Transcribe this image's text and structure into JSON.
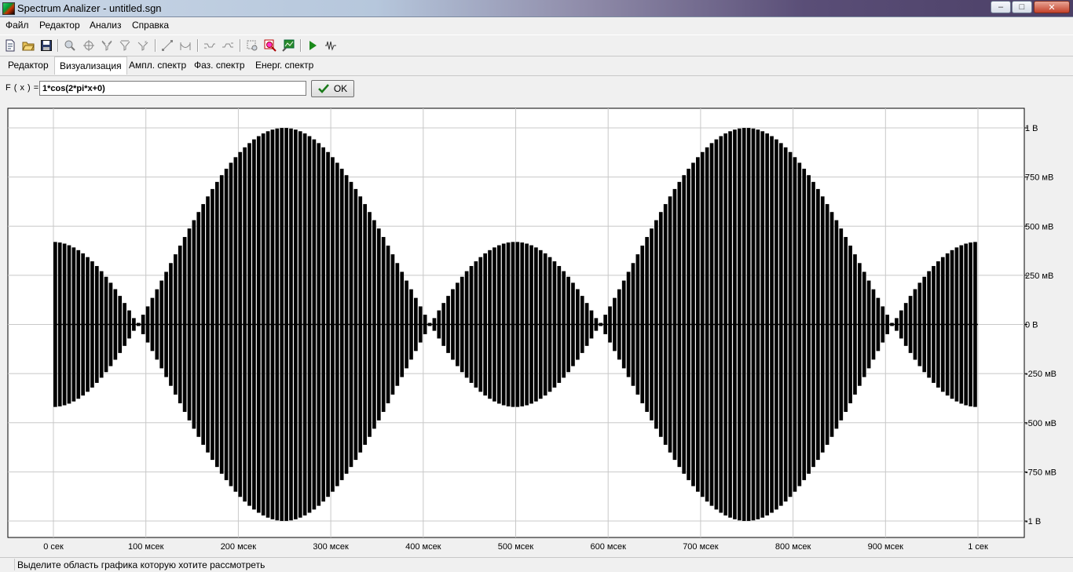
{
  "window": {
    "title": "Spectrum Analizer - untitled.sgn",
    "controls": {
      "minimize": "–",
      "maximize": "□",
      "close": "✕"
    }
  },
  "menu": [
    "Файл",
    "Редактор",
    "Анализ",
    "Справка"
  ],
  "toolbar": {
    "icons": [
      "new-file-icon",
      "open-folder-icon",
      "save-icon",
      "zoom-icon",
      "target-icon",
      "filter-icon",
      "filter2-icon",
      "filter3-icon",
      "line-icon",
      "bridge-icon",
      "wave-left-icon",
      "wave-right-icon",
      "select-rect-icon",
      "zoom-rect-icon",
      "chart-icon",
      "play-icon",
      "signal-icon"
    ]
  },
  "tabs": [
    {
      "label": "Редактор",
      "active": false
    },
    {
      "label": "Визуализация",
      "active": true
    },
    {
      "label": "Ампл. спектр",
      "active": false
    },
    {
      "label": "Фаз. спектр",
      "active": false
    },
    {
      "label": "Енерг. спектр",
      "active": false
    }
  ],
  "formula": {
    "label": "F ( x ) =",
    "value": "1*cos(2*pi*x+0)",
    "ok_label": "OK"
  },
  "status": {
    "text": "Выделите область графика которую хотите рассмотреть"
  },
  "chart_data": {
    "type": "line",
    "title": "",
    "xlabel": "",
    "ylabel": "",
    "x_ticks": [
      "0 сек",
      "100 мсек",
      "200 мсек",
      "300 мсек",
      "400 мсек",
      "500 мсек",
      "600 мсек",
      "700 мсек",
      "800 мсек",
      "900 мсек",
      "1 сек"
    ],
    "y_ticks": [
      "1 В",
      "750 мВ",
      "500 мВ",
      "250 мВ",
      "0 В",
      "-250 мВ",
      "-500 мВ",
      "-750 мВ",
      "-1 В"
    ],
    "xlim": [
      0,
      1
    ],
    "ylim": [
      -1,
      1
    ],
    "grid": true,
    "y_axis_position": "right",
    "background": "#ffffff",
    "series_color": "#000000",
    "samples": 200,
    "function": "1*cos(2*pi*x+0)",
    "envelope_peaks": [
      {
        "x": 0,
        "y": 0.42
      },
      {
        "x": 0.25,
        "y": 1.0
      },
      {
        "x": 0.5,
        "y": 0.42
      },
      {
        "x": 0.75,
        "y": 1.0
      },
      {
        "x": 1.0,
        "y": 0.42
      }
    ]
  }
}
